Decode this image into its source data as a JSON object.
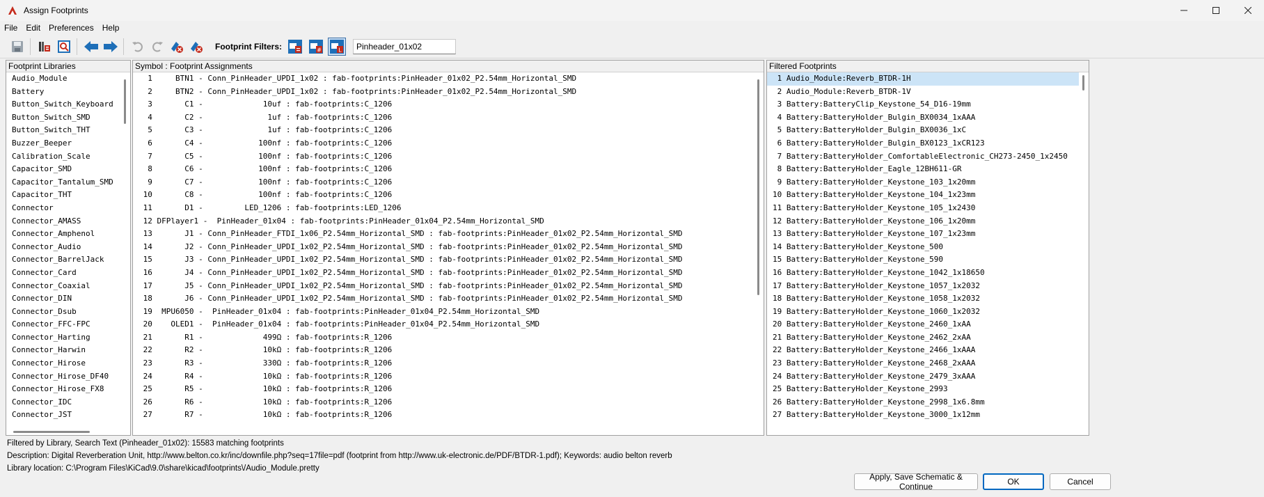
{
  "window": {
    "title": "Assign Footprints"
  },
  "menu": [
    "File",
    "Edit",
    "Preferences",
    "Help"
  ],
  "toolbar": {
    "filters_label": "Footprint Filters:",
    "filter_value": "Pinheader_01x02"
  },
  "left_panel": {
    "header": "Footprint Libraries",
    "items": [
      "Audio_Module",
      "Battery",
      "Button_Switch_Keyboard",
      "Button_Switch_SMD",
      "Button_Switch_THT",
      "Buzzer_Beeper",
      "Calibration_Scale",
      "Capacitor_SMD",
      "Capacitor_Tantalum_SMD",
      "Capacitor_THT",
      "Connector",
      "Connector_AMASS",
      "Connector_Amphenol",
      "Connector_Audio",
      "Connector_BarrelJack",
      "Connector_Card",
      "Connector_Coaxial",
      "Connector_DIN",
      "Connector_Dsub",
      "Connector_FFC-FPC",
      "Connector_Harting",
      "Connector_Harwin",
      "Connector_Hirose",
      "Connector_Hirose_DF40",
      "Connector_Hirose_FX8",
      "Connector_IDC",
      "Connector_JST"
    ]
  },
  "middle_panel": {
    "header": "Symbol : Footprint Assignments",
    "rows": [
      "  1     BTN1 - Conn_PinHeader_UPDI_1x02 : fab-footprints:PinHeader_01x02_P2.54mm_Horizontal_SMD",
      "  2     BTN2 - Conn_PinHeader_UPDI_1x02 : fab-footprints:PinHeader_01x02_P2.54mm_Horizontal_SMD",
      "  3       C1 -             10uf : fab-footprints:C_1206",
      "  4       C2 -              1uf : fab-footprints:C_1206",
      "  5       C3 -              1uf : fab-footprints:C_1206",
      "  6       C4 -            100nf : fab-footprints:C_1206",
      "  7       C5 -            100nf : fab-footprints:C_1206",
      "  8       C6 -            100nf : fab-footprints:C_1206",
      "  9       C7 -            100nf : fab-footprints:C_1206",
      " 10       C8 -            100nf : fab-footprints:C_1206",
      " 11       D1 -         LED_1206 : fab-footprints:LED_1206",
      " 12 DFPlayer1 -  PinHeader_01x04 : fab-footprints:PinHeader_01x04_P2.54mm_Horizontal_SMD",
      " 13       J1 - Conn_PinHeader_FTDI_1x06_P2.54mm_Horizontal_SMD : fab-footprints:PinHeader_01x02_P2.54mm_Horizontal_SMD",
      " 14       J2 - Conn_PinHeader_UPDI_1x02_P2.54mm_Horizontal_SMD : fab-footprints:PinHeader_01x02_P2.54mm_Horizontal_SMD",
      " 15       J3 - Conn_PinHeader_UPDI_1x02_P2.54mm_Horizontal_SMD : fab-footprints:PinHeader_01x02_P2.54mm_Horizontal_SMD",
      " 16       J4 - Conn_PinHeader_UPDI_1x02_P2.54mm_Horizontal_SMD : fab-footprints:PinHeader_01x02_P2.54mm_Horizontal_SMD",
      " 17       J5 - Conn_PinHeader_UPDI_1x02_P2.54mm_Horizontal_SMD : fab-footprints:PinHeader_01x02_P2.54mm_Horizontal_SMD",
      " 18       J6 - Conn_PinHeader_UPDI_1x02_P2.54mm_Horizontal_SMD : fab-footprints:PinHeader_01x02_P2.54mm_Horizontal_SMD",
      " 19  MPU6050 -  PinHeader_01x04 : fab-footprints:PinHeader_01x04_P2.54mm_Horizontal_SMD",
      " 20    OLED1 -  PinHeader_01x04 : fab-footprints:PinHeader_01x04_P2.54mm_Horizontal_SMD",
      " 21       R1 -             499Ω : fab-footprints:R_1206",
      " 22       R2 -             10kΩ : fab-footprints:R_1206",
      " 23       R3 -             330Ω : fab-footprints:R_1206",
      " 24       R4 -             10kΩ : fab-footprints:R_1206",
      " 25       R5 -             10kΩ : fab-footprints:R_1206",
      " 26       R6 -             10kΩ : fab-footprints:R_1206",
      " 27       R7 -             10kΩ : fab-footprints:R_1206"
    ]
  },
  "right_panel": {
    "header": "Filtered Footprints",
    "rows": [
      " 1 Audio_Module:Reverb_BTDR-1H",
      " 2 Audio_Module:Reverb_BTDR-1V",
      " 3 Battery:BatteryClip_Keystone_54_D16-19mm",
      " 4 Battery:BatteryHolder_Bulgin_BX0034_1xAAA",
      " 5 Battery:BatteryHolder_Bulgin_BX0036_1xC",
      " 6 Battery:BatteryHolder_Bulgin_BX0123_1xCR123",
      " 7 Battery:BatteryHolder_ComfortableElectronic_CH273-2450_1x2450",
      " 8 Battery:BatteryHolder_Eagle_12BH611-GR",
      " 9 Battery:BatteryHolder_Keystone_103_1x20mm",
      "10 Battery:BatteryHolder_Keystone_104_1x23mm",
      "11 Battery:BatteryHolder_Keystone_105_1x2430",
      "12 Battery:BatteryHolder_Keystone_106_1x20mm",
      "13 Battery:BatteryHolder_Keystone_107_1x23mm",
      "14 Battery:BatteryHolder_Keystone_500",
      "15 Battery:BatteryHolder_Keystone_590",
      "16 Battery:BatteryHolder_Keystone_1042_1x18650",
      "17 Battery:BatteryHolder_Keystone_1057_1x2032",
      "18 Battery:BatteryHolder_Keystone_1058_1x2032",
      "19 Battery:BatteryHolder_Keystone_1060_1x2032",
      "20 Battery:BatteryHolder_Keystone_2460_1xAA",
      "21 Battery:BatteryHolder_Keystone_2462_2xAA",
      "22 Battery:BatteryHolder_Keystone_2466_1xAAA",
      "23 Battery:BatteryHolder_Keystone_2468_2xAAA",
      "24 Battery:BatteryHolder_Keystone_2479_3xAAA",
      "25 Battery:BatteryHolder_Keystone_2993",
      "26 Battery:BatteryHolder_Keystone_2998_1x6.8mm",
      "27 Battery:BatteryHolder_Keystone_3000_1x12mm"
    ]
  },
  "info": {
    "filter_status": "Filtered by Library, Search Text (Pinheader_01x02): 15583 matching footprints",
    "description": "Description: Digital Reverberation Unit, http://www.belton.co.kr/inc/downfile.php?seq=17file=pdf (footprint from http://www.uk-electronic.de/PDF/BTDR-1.pdf);  Keywords: audio belton reverb",
    "library_location": "Library location: C:\\Program Files\\KiCad\\9.0\\share\\kicad\\footprints\\/Audio_Module.pretty"
  },
  "buttons": {
    "apply": "Apply, Save Schematic & Continue",
    "ok": "OK",
    "cancel": "Cancel"
  },
  "colors": {
    "selection": "#cce4f7",
    "accent": "#0067c0",
    "icon_red": "#c42b1c",
    "icon_blue": "#1e6fb8"
  }
}
